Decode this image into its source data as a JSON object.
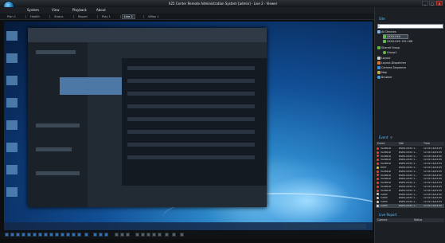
{
  "window": {
    "title": "X25 Center Remote Administration System [admin] - Live 2 - Viewer",
    "min": "_",
    "max": "□",
    "close": "x"
  },
  "menu": [
    "System",
    "View",
    "Playback",
    "About"
  ],
  "tabs": [
    {
      "label": "Plan 1"
    },
    {
      "label": "Health"
    },
    {
      "label": "Status"
    },
    {
      "label": "Report"
    },
    {
      "label": "Play 1"
    },
    {
      "label": "Live 2"
    },
    {
      "label": "ViBox 1"
    }
  ],
  "sidebar": {
    "title": "Site",
    "search_placeholder": "",
    "tree": [
      {
        "label": "All Devices",
        "color": "#7fb7e6"
      },
      {
        "label": "XXXX-XXX",
        "color": "#62b84a"
      },
      {
        "label": "XXXX-XXX 192.168",
        "color": "#62b84a"
      },
      {
        "label": "Shared Group",
        "color": "#62b84a"
      },
      {
        "label": "Group1",
        "color": "#62b84a"
      },
      {
        "label": "Layout",
        "color": "#d4d4d4"
      },
      {
        "label": "Layout-Dispatcher",
        "color": "#e07a3a"
      },
      {
        "label": "Camera Sequence",
        "color": "#3a8fe0"
      },
      {
        "label": "Map",
        "color": "#c2a75a"
      },
      {
        "label": "Browser",
        "color": "#4aa3e0"
      }
    ]
  },
  "events": {
    "title": "Event",
    "columns": [
      "Event",
      "Site",
      "Time"
    ],
    "rows": [
      {
        "event": "VA-BOLD",
        "site": "RSDS-XXXX 1...",
        "time": "12:09 14/04:05",
        "color": "#e0453a"
      },
      {
        "event": "VA-BOLD",
        "site": "RSDS-XXXX 1...",
        "time": "12:09 14/04:05",
        "color": "#e0453a"
      },
      {
        "event": "VA-BOLD",
        "site": "RSDS-XXXX 1...",
        "time": "12:09 14/04:05",
        "color": "#e0453a"
      },
      {
        "event": "VA-BOLD",
        "site": "RSDS-XXXX 1...",
        "time": "12:09 14/04:05",
        "color": "#e0453a"
      },
      {
        "event": "VA-BOLD",
        "site": "RSDS-XXXX 1...",
        "time": "12:09 14/04:05",
        "color": "#e0453a"
      },
      {
        "event": "DINT",
        "site": "RSDS-XXXX 1...",
        "time": "12:09 14/04:05",
        "color": "#e0d23a"
      },
      {
        "event": "VA-BOLD",
        "site": "RSDS-XXXX 1...",
        "time": "12:09 14/04:05",
        "color": "#e0453a"
      },
      {
        "event": "VA-BOLD",
        "site": "RSDS-XXXX 1...",
        "time": "12:09 14/04:05",
        "color": "#e0453a"
      },
      {
        "event": "VA-BOLD",
        "site": "RSDS-XXXX 1...",
        "time": "12:09 14/04:05",
        "color": "#e0453a"
      },
      {
        "event": "VA-BOLD",
        "site": "RSDS-XXXX 1...",
        "time": "12:09 14/04:05",
        "color": "#e0453a"
      },
      {
        "event": "VA-BOLD",
        "site": "RSDS-XXXX 1...",
        "time": "12:09 14/04:05",
        "color": "#e0453a"
      },
      {
        "event": "VA-BOLD",
        "site": "RSDS-XXXX 1...",
        "time": "12:09 14/04:05",
        "color": "#e0453a"
      },
      {
        "event": "CAM3",
        "site": "RSDS-XXXX 1...",
        "time": "12:09 14/04:05",
        "color": "#d4d4d4"
      },
      {
        "event": "CAM3",
        "site": "RSDS-XXXX 1...",
        "time": "12:09 14/04:05",
        "color": "#d4d4d4"
      },
      {
        "event": "CAM3",
        "site": "RSDS-XXXX 1...",
        "time": "12:09 14/04:05",
        "color": "#d4d4d4"
      },
      {
        "event": "CAM3",
        "site": "RSDS-XXXX 1...",
        "time": "12:09 14/04:05",
        "color": "#d4d4d4"
      }
    ]
  },
  "commands": {
    "title": "Live Report",
    "columns": [
      "Camera",
      "Status"
    ]
  }
}
